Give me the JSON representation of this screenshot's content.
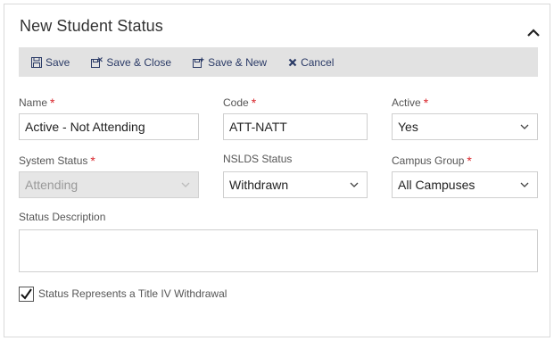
{
  "form": {
    "title": "New Student Status",
    "collapse_icon": "chevron-up-icon"
  },
  "toolbar": {
    "save_label": "Save",
    "save_close_label": "Save & Close",
    "save_new_label": "Save & New",
    "cancel_label": "Cancel"
  },
  "fields": {
    "name": {
      "label": "Name",
      "value": "Active - Not Attending",
      "required": "*"
    },
    "code": {
      "label": "Code",
      "value": "ATT-NATT",
      "required": "*"
    },
    "active": {
      "label": "Active",
      "value": "Yes",
      "required": "*"
    },
    "system_status": {
      "label": "System Status",
      "value": "Attending",
      "required": "*"
    },
    "nslds_status": {
      "label": "NSLDS Status",
      "value": "Withdrawn"
    },
    "campus_group": {
      "label": "Campus Group",
      "value": "All Campuses",
      "required": "*"
    },
    "status_description": {
      "label": "Status Description",
      "value": ""
    },
    "title_iv": {
      "label": "Status Represents a Title IV Withdrawal",
      "checked": true
    }
  },
  "colors": {
    "toolbar_bg": "#e2e2e2",
    "required": "#d9262c",
    "link": "#2a3a66"
  }
}
